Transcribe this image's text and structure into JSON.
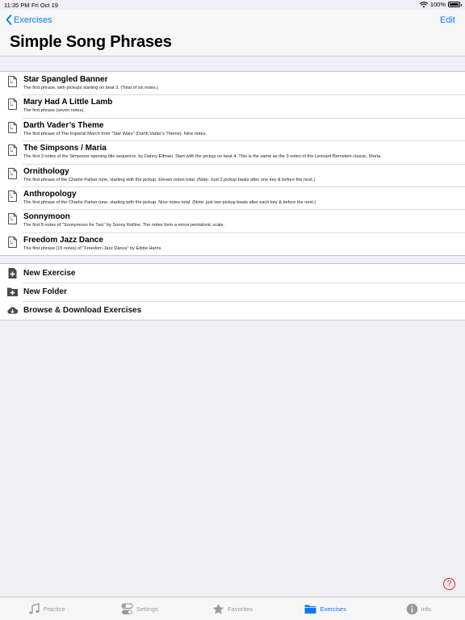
{
  "status_bar": {
    "time": "11:35 PM",
    "date": "Fri Oct 19",
    "battery": "100%"
  },
  "nav": {
    "back_label": "Exercises",
    "edit_label": "Edit",
    "title": "Simple Song Phrases"
  },
  "exercises": [
    {
      "title": "Star Spangled Banner",
      "subtitle": "The first phrase, with pickups starting on beat 3. (Total of six notes.)"
    },
    {
      "title": "Mary Had A Little Lamb",
      "subtitle": "The first phrase (seven notes)."
    },
    {
      "title": "Darth Vader’s Theme",
      "subtitle": "The first phrase of The Imperial March from \"Star Wars\" (Darth Vader’s Theme). Nine notes."
    },
    {
      "title": "The Simpsons / Maria",
      "subtitle": "The first 3 notes of the Simpsons opening title sequence, by Danny Elfman. Start with the pickup on beat 4. This is the same as the 3 notes of the Leonard Bernstein classic, Maria."
    },
    {
      "title": "Ornithology",
      "subtitle": "The first phrase of the Charlie Parker tune, starting with the pickup. Eleven notes total. (Note: Just 2 pickup beats after one key & before the next.)"
    },
    {
      "title": "Anthropology",
      "subtitle": "The first phrase of the Charlie Parker tune, starting with the pickup. Nine notes total. (Note: just two pickup beats after each key & before the next.)"
    },
    {
      "title": "Sonnymoon",
      "subtitle": "The first 8 notes of \"Sonnymoon for Two\" by Sonny Rollins. The notes form a minor pentatonic scale."
    },
    {
      "title": "Freedom Jazz Dance",
      "subtitle": "The first phrase (15 notes) of \"Freedom Jazz Dance\" by Eddie Harris."
    }
  ],
  "actions": {
    "new_exercise": "New Exercise",
    "new_folder": "New Folder",
    "browse": "Browse & Download Exercises"
  },
  "help_label": "?",
  "tabs": {
    "practice": "Practice",
    "settings": "Settings",
    "favorites": "Favorites",
    "exercises": "Exercises",
    "info": "Info"
  },
  "colors": {
    "accent": "#007aff",
    "background": "#efeff4",
    "help": "#e02020",
    "inactive_tab": "#999999"
  },
  "icons": {
    "back": "chevron-left-icon",
    "exercise": "document-icon",
    "new_exercise": "document-plus-icon",
    "new_folder": "folder-plus-icon",
    "browse": "cloud-download-icon"
  }
}
